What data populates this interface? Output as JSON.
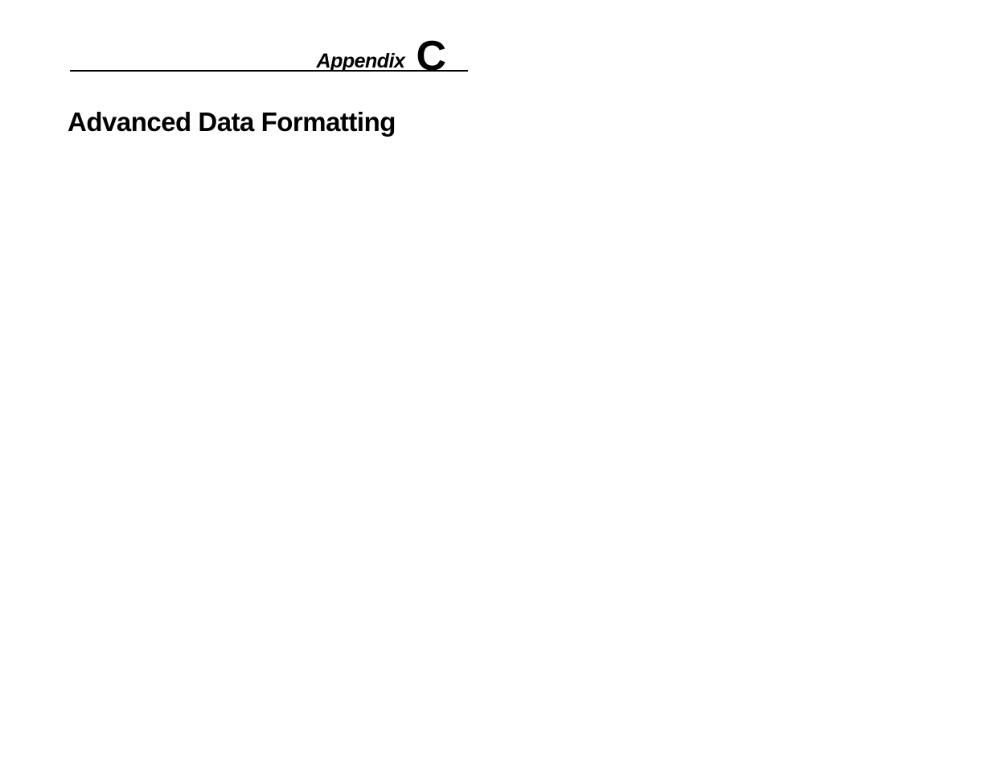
{
  "header": {
    "label": "Appendix",
    "letter": "C"
  },
  "title": "Advanced Data Formatting"
}
